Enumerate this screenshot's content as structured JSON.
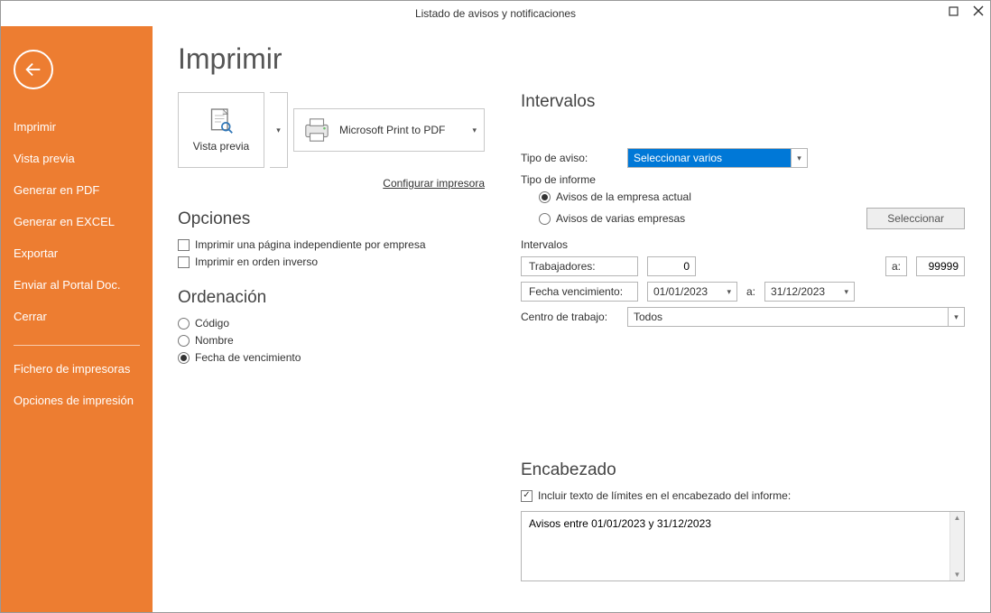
{
  "window": {
    "title": "Listado de avisos y notificaciones"
  },
  "sidebar": {
    "items": [
      "Imprimir",
      "Vista previa",
      "Generar en PDF",
      "Generar en EXCEL",
      "Exportar",
      "Enviar al Portal Doc.",
      "Cerrar"
    ],
    "items2": [
      "Fichero de impresoras",
      "Opciones de impresión"
    ]
  },
  "page": {
    "title": "Imprimir",
    "vista_previa": "Vista previa",
    "printer_name": "Microsoft Print to PDF",
    "config_link": "Configurar impresora"
  },
  "opciones": {
    "heading": "Opciones",
    "chk_pagina_indep": "Imprimir una página independiente por empresa",
    "chk_orden_inverso": "Imprimir en orden inverso",
    "chk_pagina_indep_checked": false,
    "chk_orden_inverso_checked": false
  },
  "ordenacion": {
    "heading": "Ordenación",
    "opt_codigo": "Código",
    "opt_nombre": "Nombre",
    "opt_fecha": "Fecha de vencimiento",
    "selected": "fecha"
  },
  "intervalos": {
    "heading": "Intervalos",
    "tipo_aviso_label": "Tipo de aviso:",
    "tipo_aviso_value": "Seleccionar varios",
    "tipo_informe_label": "Tipo de informe",
    "opt_empresa_actual": "Avisos de la empresa actual",
    "opt_varias_empresas": "Avisos de varias empresas",
    "tipo_informe_selected": "actual",
    "seleccionar_btn": "Seleccionar",
    "sub_heading": "Intervalos",
    "trabajadores_label": "Trabajadores:",
    "trabajadores_from": "0",
    "trabajadores_to": "99999",
    "a_label": "a:",
    "fecha_venc_label": "Fecha vencimiento:",
    "fecha_from": "01/01/2023",
    "fecha_to": "31/12/2023",
    "centro_label": "Centro de trabajo:",
    "centro_value": "Todos"
  },
  "encabezado": {
    "heading": "Encabezado",
    "chk_incluir": "Incluir texto de límites en el encabezado del informe:",
    "chk_incluir_checked": true,
    "text": "Avisos entre 01/01/2023 y 31/12/2023"
  }
}
